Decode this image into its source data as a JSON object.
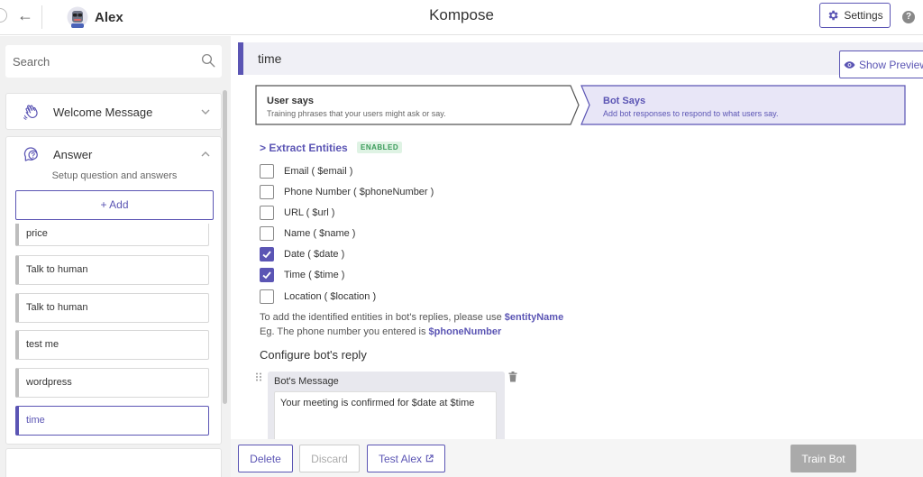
{
  "header": {
    "bot_name": "Alex",
    "app_title": "Kompose",
    "settings_label": "Settings",
    "help_glyph": "?",
    "back_glyph": "←"
  },
  "sidebar": {
    "search_placeholder": "Search",
    "welcome": {
      "title": "Welcome Message"
    },
    "answer": {
      "title": "Answer",
      "subtitle": "Setup question and answers",
      "add_label": "+ Add",
      "items": [
        {
          "label": "price",
          "active": false
        },
        {
          "label": "Talk to human",
          "active": false
        },
        {
          "label": "Talk to human",
          "active": false
        },
        {
          "label": "test me",
          "active": false
        },
        {
          "label": "wordpress",
          "active": false
        },
        {
          "label": "time",
          "active": true
        }
      ]
    }
  },
  "main": {
    "intent_title": "time",
    "show_preview_label": "Show Preview",
    "tabs": [
      {
        "label": "User says",
        "description": "Training phrases that your users might ask or say.",
        "active": false
      },
      {
        "label": "Bot Says",
        "description": "Add bot responses to respond to what users say.",
        "active": true
      }
    ],
    "extract_label": "> Extract Entities",
    "enabled_badge": "ENABLED",
    "entities": [
      {
        "label": "Email ( $email )",
        "checked": false
      },
      {
        "label": "Phone Number ( $phoneNumber )",
        "checked": false
      },
      {
        "label": "URL ( $url )",
        "checked": false
      },
      {
        "label": "Name ( $name )",
        "checked": false
      },
      {
        "label": "Date ( $date )",
        "checked": true
      },
      {
        "label": "Time ( $time )",
        "checked": true
      },
      {
        "label": "Location ( $location )",
        "checked": false
      }
    ],
    "note1_text": "To add the identified entities in bot's replies, please use ",
    "note1_code": "$entityName",
    "note2_text": "Eg. The phone number you entered is ",
    "note2_code": "$phoneNumber",
    "configure_label": "Configure bot's reply",
    "bot_message_header": "Bot's Message",
    "bot_message_text": "Your meeting is confirmed for $date at $time"
  },
  "footer": {
    "delete_label": "Delete",
    "discard_label": "Discard",
    "test_label": "Test Alex",
    "train_label": "Train Bot"
  },
  "colors": {
    "accent": "#5b55b4",
    "badge_bg": "#dff3e4",
    "badge_text": "#3a9b5a",
    "disabled": "#aaaaaa"
  },
  "icons": {
    "back": "arrow-left-icon",
    "settings": "gear-icon",
    "help": "help-icon",
    "search": "search-icon",
    "welcome": "waving-hand-icon",
    "answer": "chat-question-icon",
    "preview": "eye-icon",
    "drag": "drag-handle-icon",
    "delete": "trash-icon",
    "external": "external-link-icon"
  }
}
